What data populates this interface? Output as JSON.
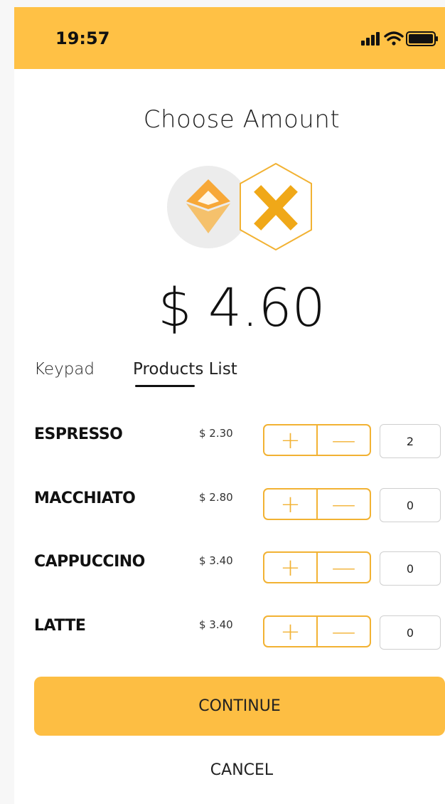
{
  "status_bar": {
    "time": "19:57",
    "icons": [
      "signal-icon",
      "wifi-icon",
      "battery-icon"
    ]
  },
  "header": {
    "title": "Choose Amount"
  },
  "logos": [
    "diamond-logo-icon",
    "x-hexagon-logo-icon"
  ],
  "amount": "$ 4.60",
  "tabs": [
    {
      "label": "Keypad",
      "active": false
    },
    {
      "label": "Products List",
      "active": true
    }
  ],
  "products": [
    {
      "name": "ESPRESSO",
      "price": "$ 2.30",
      "quantity": "2"
    },
    {
      "name": "MACCHIATO",
      "price": "$ 2.80",
      "quantity": "0"
    },
    {
      "name": "CAPPUCCINO",
      "price": "$ 3.40",
      "quantity": "0"
    },
    {
      "name": "LATTE",
      "price": "$ 3.40",
      "quantity": "0"
    }
  ],
  "stepper": {
    "plus": "+",
    "minus": "—"
  },
  "actions": {
    "continue_label": "CONTINUE",
    "cancel_label": "CANCEL"
  },
  "colors": {
    "accent": "#ffc145",
    "stepper_border": "#f2b233"
  }
}
